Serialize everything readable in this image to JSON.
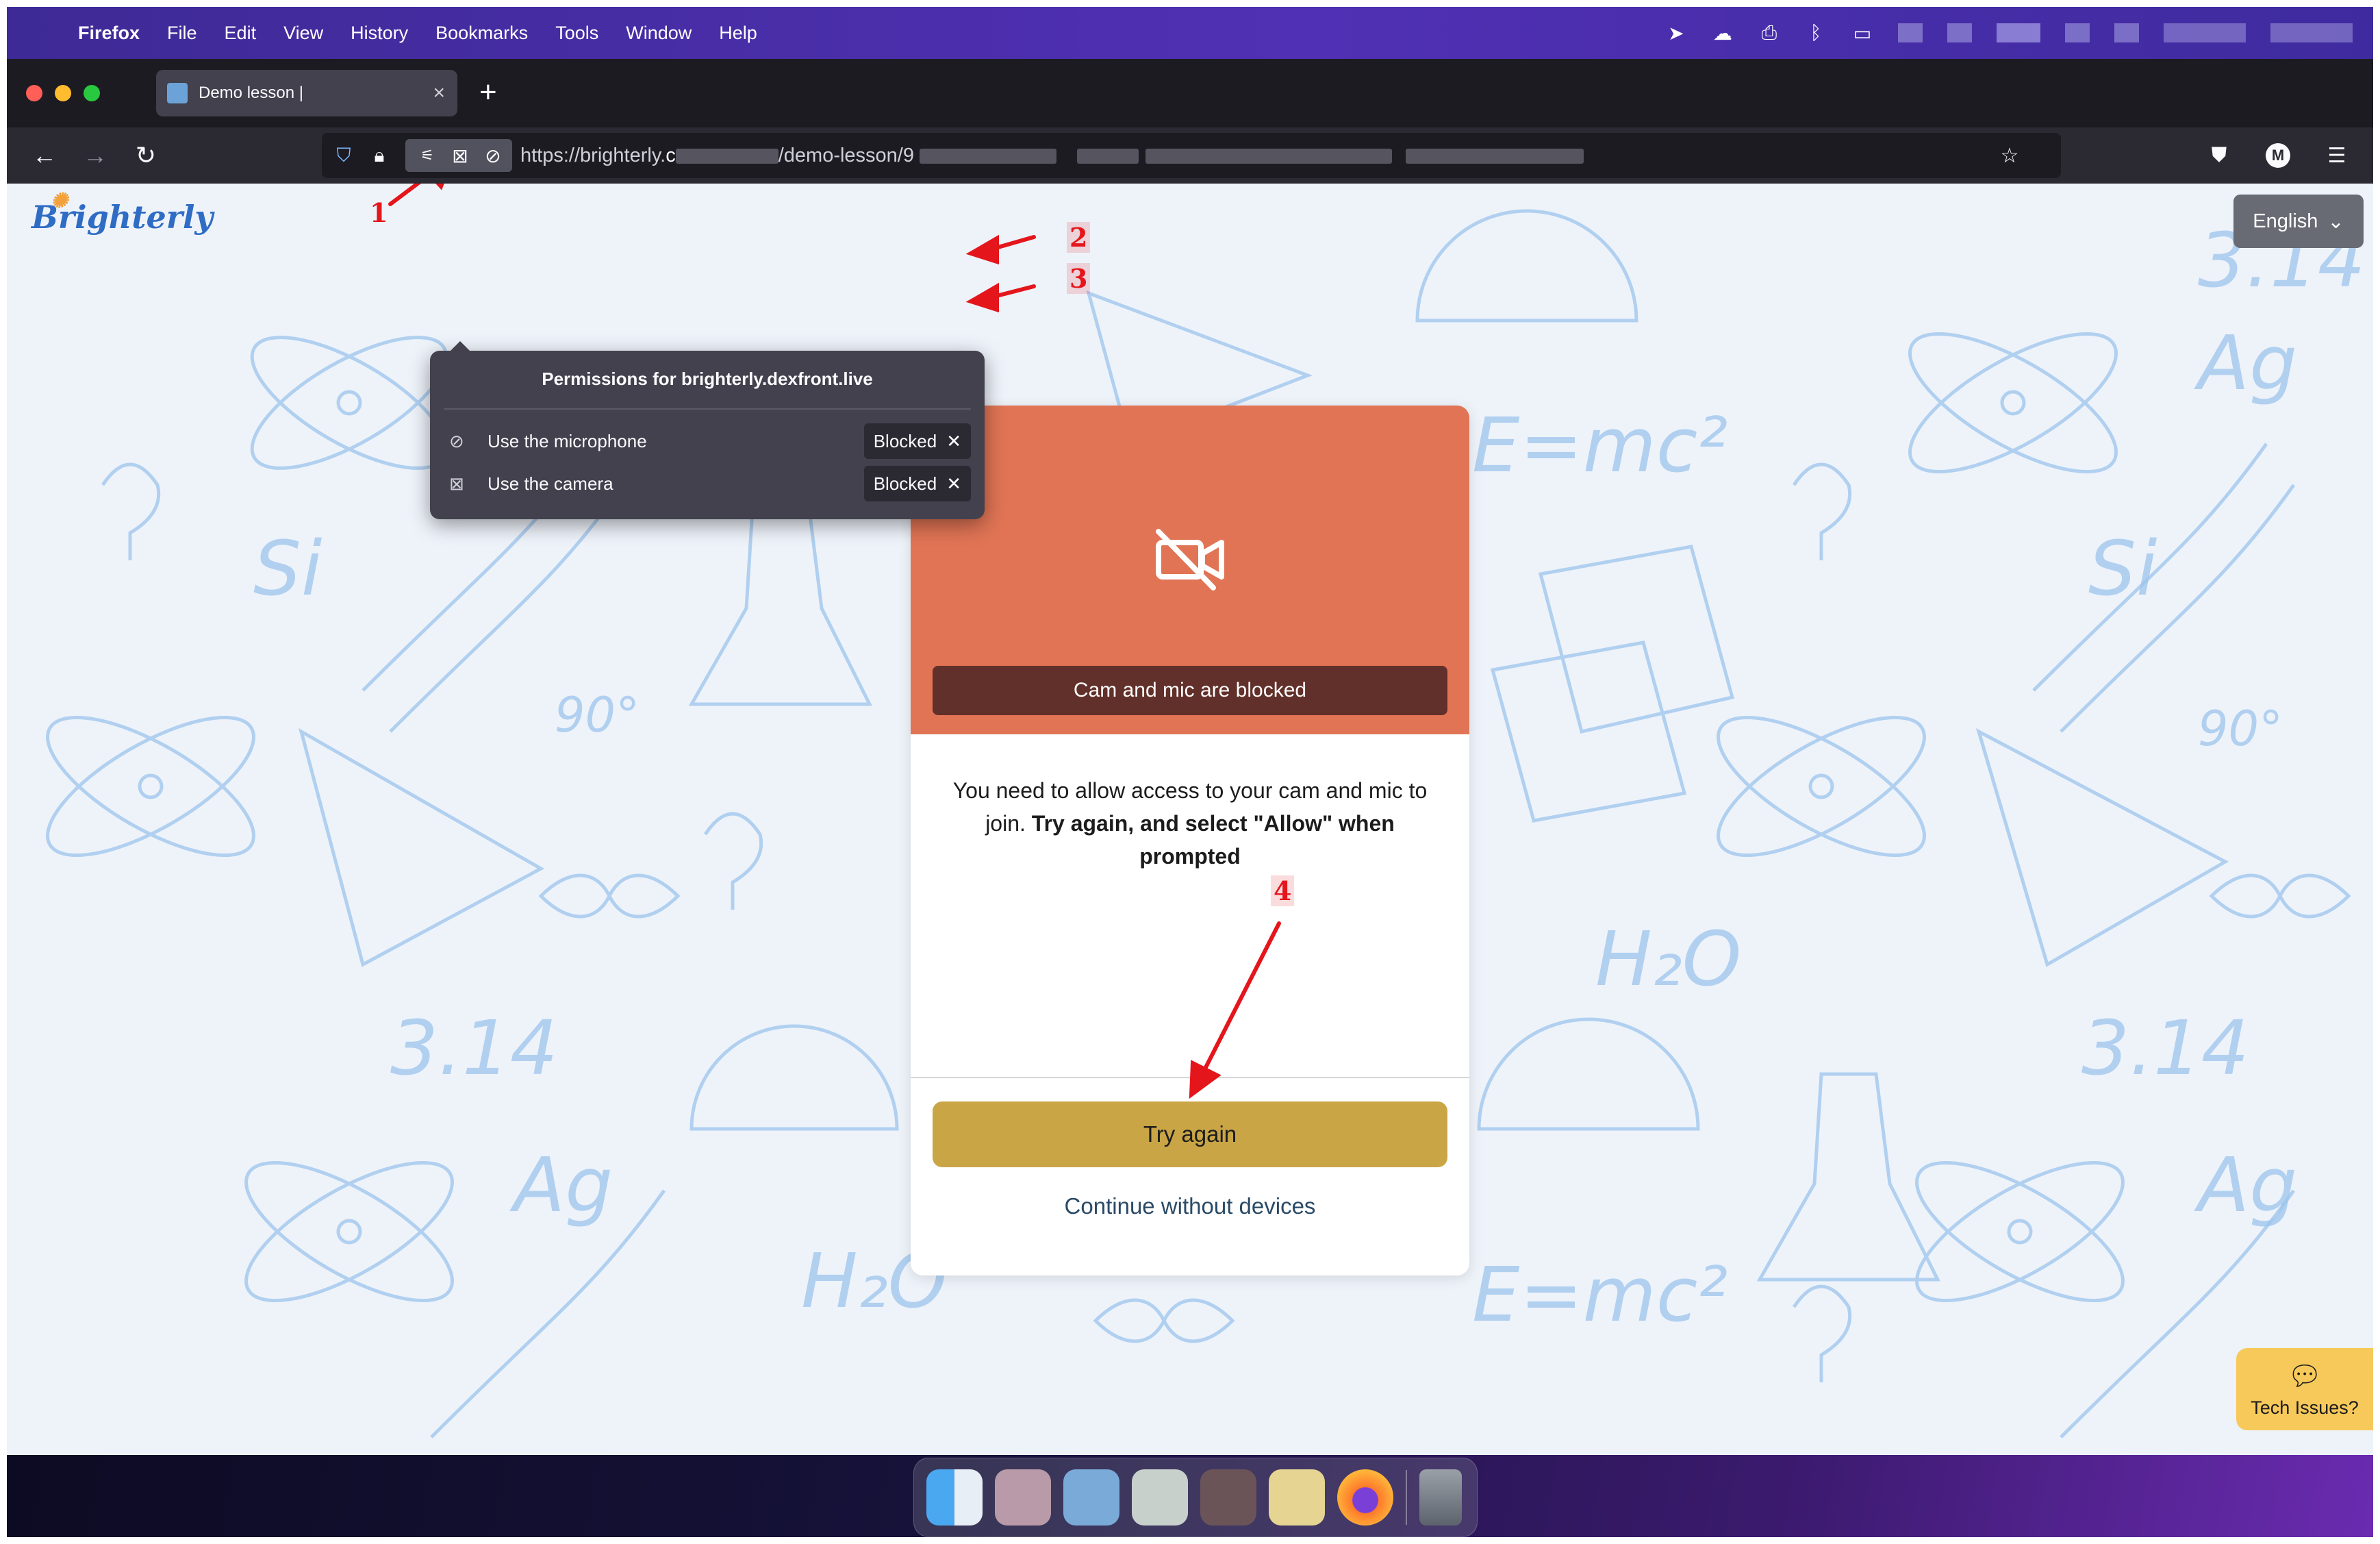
{
  "menubar": {
    "app": "Firefox",
    "items": [
      "File",
      "Edit",
      "View",
      "History",
      "Bookmarks",
      "Tools",
      "Window",
      "Help"
    ]
  },
  "browser": {
    "tab_title": "Demo lesson |",
    "url_prefix": "https://brighterly.",
    "url_bold_char": "c",
    "url_path": "/demo-lesson/9"
  },
  "page": {
    "logo": "Brighterly",
    "language": "English"
  },
  "permissions": {
    "title": "Permissions for brighterly.dexfront.live",
    "rows": [
      {
        "label": "Use the microphone",
        "status": "Blocked"
      },
      {
        "label": "Use the camera",
        "status": "Blocked"
      }
    ]
  },
  "annotations": [
    "1",
    "2",
    "3",
    "4"
  ],
  "modal": {
    "banner": "Cam and mic are blocked",
    "message_plain": "You need to allow access to your cam and mic to join. ",
    "message_bold": "Try again, and select \"Allow\" when prompted",
    "try_again": "Try again",
    "continue": "Continue without devices"
  },
  "tech_issues": "Tech Issues?",
  "colors": {
    "modal_header": "#e07455",
    "banner": "#62302a",
    "try_button": "#c9a545",
    "annotation": "#e4161b",
    "menubar": "#4a2ba0"
  }
}
